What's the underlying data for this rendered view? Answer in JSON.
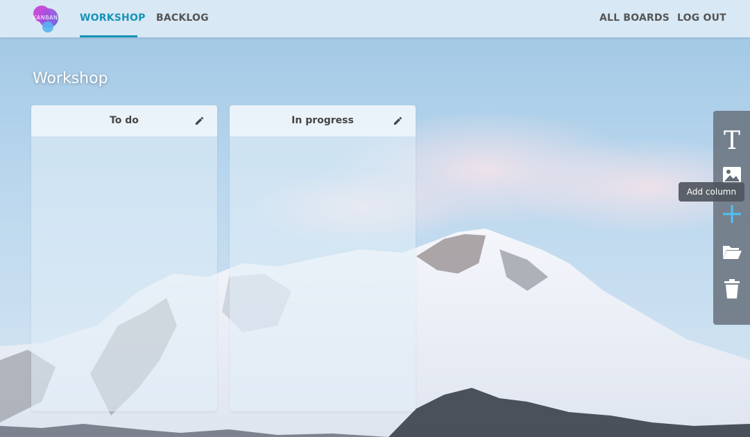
{
  "header": {
    "logo_text": "KANBAN",
    "nav": [
      {
        "label": "WORKSHOP",
        "active": true
      },
      {
        "label": "BACKLOG",
        "active": false
      }
    ],
    "right_nav": [
      {
        "label": "ALL BOARDS"
      },
      {
        "label": "LOG OUT"
      }
    ],
    "accent_color": "#1693b7"
  },
  "board": {
    "title": "Workshop",
    "columns": [
      {
        "title": "To do",
        "icon": "pencil-icon"
      },
      {
        "title": "In progress",
        "icon": "pencil-icon"
      }
    ]
  },
  "toolbar": {
    "tools": [
      {
        "icon": "text-icon"
      },
      {
        "icon": "image-icon"
      },
      {
        "icon": "plus-icon",
        "color": "#4fc3f7"
      },
      {
        "icon": "folder-open-icon"
      },
      {
        "icon": "trash-icon"
      }
    ],
    "tooltip": "Add column"
  }
}
